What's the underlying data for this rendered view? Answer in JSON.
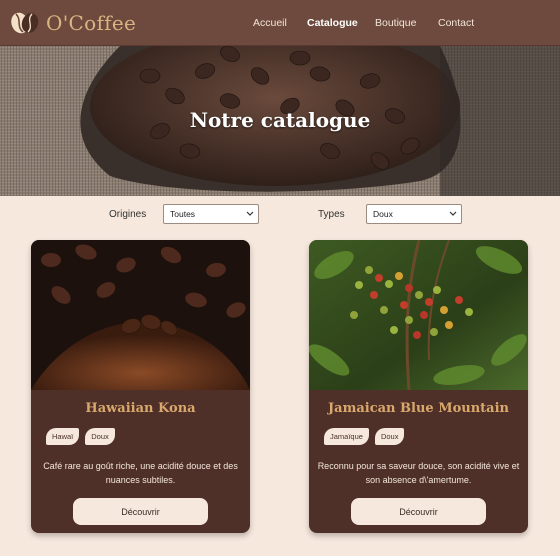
{
  "header": {
    "brand": "O'Coffee",
    "nav": [
      {
        "label": "Accueil",
        "active": false
      },
      {
        "label": "Catalogue",
        "active": true
      },
      {
        "label": "Boutique",
        "active": false
      },
      {
        "label": "Contact",
        "active": false
      }
    ]
  },
  "hero": {
    "title": "Notre catalogue"
  },
  "filters": {
    "origins_label": "Origines",
    "origins_value": "Toutes",
    "types_label": "Types",
    "types_value": "Doux"
  },
  "products": [
    {
      "name": "Hawaiian Kona",
      "tags": [
        "Hawaï",
        "Doux"
      ],
      "description": "Café rare au goût riche, une acidité douce et des nuances subtiles.",
      "button": "Découvrir"
    },
    {
      "name": "Jamaican Blue Mountain",
      "tags": [
        "Jamaïque",
        "Doux"
      ],
      "description": "Reconnu pour sa saveur douce, son acidité vive et son absence d\\'amertume.",
      "button": "Découvrir"
    }
  ],
  "colors": {
    "header_bg": "#6e4a3e",
    "brand": "#d9b482",
    "page_bg": "#f6e8dd",
    "card_bg": "#4f3028",
    "card_title": "#d9a86c"
  }
}
